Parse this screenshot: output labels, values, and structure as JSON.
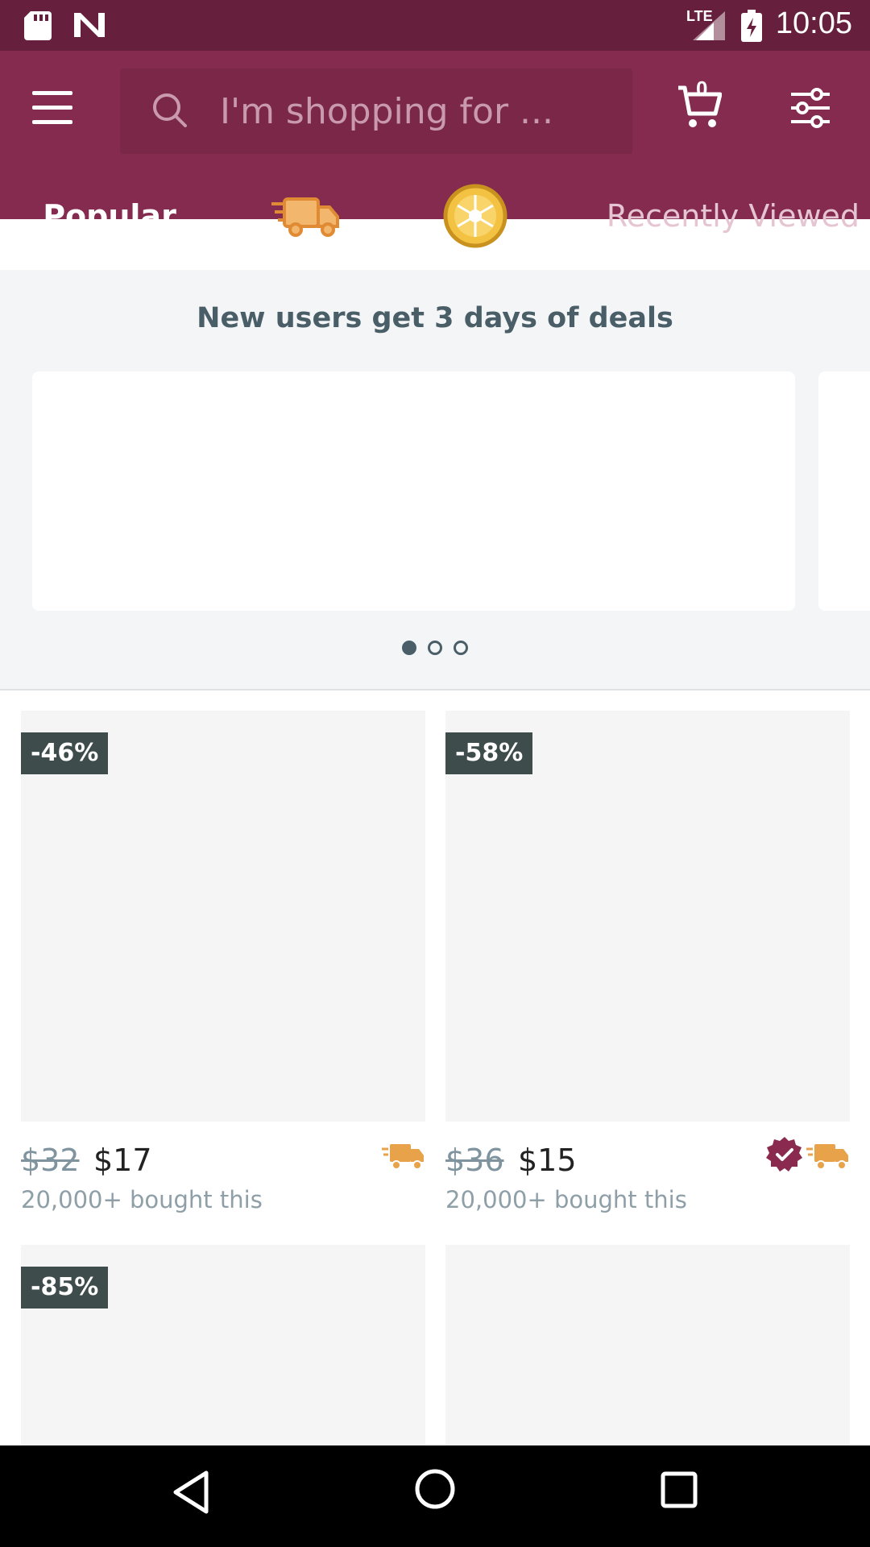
{
  "status_bar": {
    "time": "10:05",
    "network": "LTE"
  },
  "header": {
    "search_placeholder": "I'm shopping for ...",
    "cart_count": "0"
  },
  "tabs": [
    {
      "label": "Popular",
      "active": true
    },
    {
      "icon": "fast-shipping-truck-icon"
    },
    {
      "icon": "prize-wheel-icon"
    },
    {
      "label": "Recently Viewed"
    }
  ],
  "promo": {
    "title": "New users get 3 days of deals",
    "pages": 3,
    "active_page": 1
  },
  "products": [
    {
      "discount": "-46%",
      "old_price": "$32",
      "price": "$17",
      "bought": "20,000+ bought this",
      "badges": [
        "fast-shipping-truck-icon"
      ]
    },
    {
      "discount": "-58%",
      "old_price": "$36",
      "price": "$15",
      "bought": "20,000+ bought this",
      "badges": [
        "verified-badge-icon",
        "fast-shipping-truck-icon"
      ]
    },
    {
      "discount": "-85%"
    },
    {}
  ],
  "colors": {
    "brand": "#842b4f",
    "status_bar": "#661f3c",
    "shipping": "#e8a24a",
    "verified": "#8a2a4f"
  }
}
